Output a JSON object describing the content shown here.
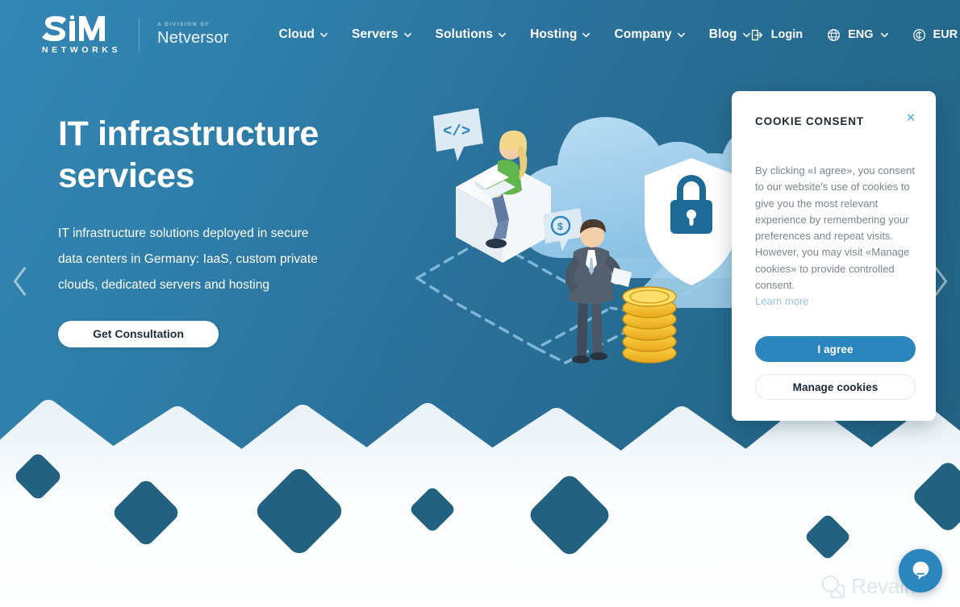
{
  "brand": {
    "logo_name": "SIM",
    "logo_sub": "NETWORKS",
    "division_label": "A DIVISION OF",
    "division_name": "Netversor"
  },
  "nav": {
    "items": [
      {
        "label": "Cloud",
        "has_dropdown": true
      },
      {
        "label": "Servers",
        "has_dropdown": true
      },
      {
        "label": "Solutions",
        "has_dropdown": true
      },
      {
        "label": "Hosting",
        "has_dropdown": true
      },
      {
        "label": "Company",
        "has_dropdown": true
      },
      {
        "label": "Blog",
        "has_dropdown": true
      }
    ]
  },
  "header_right": {
    "login_label": "Login",
    "language": "ENG",
    "currency": "EUR"
  },
  "hero": {
    "title": "IT infrastructure services",
    "subtitle": "IT infrastructure solutions deployed in secure data centers in Germany: IaaS, custom private clouds, dedicated servers and hosting",
    "cta_label": "Get Consultation",
    "prev_arrow": "previous slide",
    "next_arrow": "next slide"
  },
  "cookie": {
    "title": "COOKIE CONSENT",
    "body": "By clicking «I agree», you consent to our website's use of cookies to give you the most relevant experience by remembering your preferences and repeat visits. However, you may visit «Manage cookies» to provide controlled consent.",
    "learn_more": "Learn more",
    "agree_label": "I agree",
    "manage_label": "Manage cookies",
    "close_label": "×"
  },
  "widgets": {
    "chat_label": "Open chat",
    "watermark_text": "Revain"
  },
  "colors": {
    "hero_gradient_start": "#3386b4",
    "hero_gradient_end": "#22607f",
    "accent_blue": "#2b86be",
    "diamond_blue": "#22617f",
    "cloud_blue": "#a9d3ec",
    "cloud_blue_dark": "#7fb8dd",
    "coin_gold": "#f5c93c",
    "shirt_green": "#62b44c",
    "link_blue": "#9dc3d9",
    "text_dark": "#1b2733",
    "text_muted": "#7a8691"
  }
}
